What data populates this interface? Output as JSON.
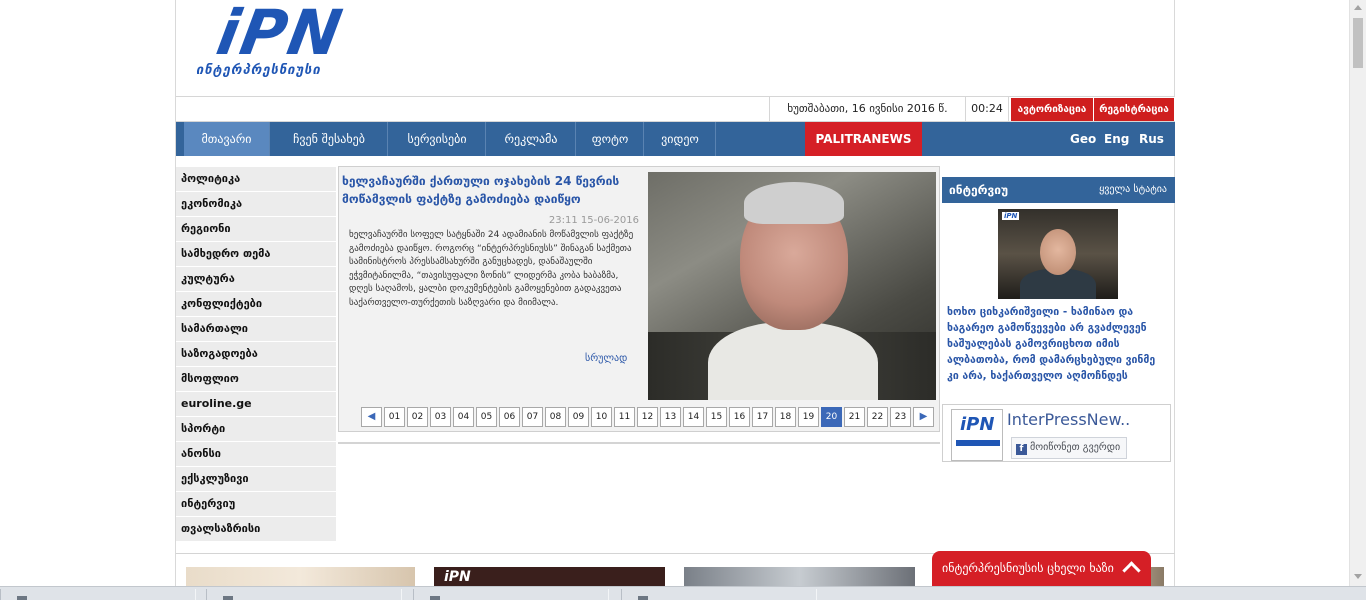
{
  "logo": {
    "mark": "iPN",
    "word": "ინტერპრესნიუსი"
  },
  "topbar": {
    "date": "ხუთშაბათი, 16 ივნისი 2016 წ.",
    "time": "00:24",
    "login_label": "ავტორიზაცია",
    "register_label": "რეგისტრაცია"
  },
  "nav": {
    "items": [
      {
        "label": "მთავარი",
        "active": true
      },
      {
        "label": "ჩვენ შესახებ",
        "active": false
      },
      {
        "label": "სერვისები",
        "active": false
      },
      {
        "label": "რეკლამა",
        "active": false
      },
      {
        "label": "ფოტო",
        "active": false
      },
      {
        "label": "ვიდეო",
        "active": false
      }
    ],
    "palitra": "PALITRANEWS",
    "languages": [
      "Geo",
      "Eng",
      "Rus"
    ]
  },
  "categories": [
    "პოლიტიკა",
    "ეკონომიკა",
    "რეგიონი",
    "სამხედრო თემა",
    "კულტურა",
    "კონფლიქტები",
    "სამართალი",
    "საზოგადოება",
    "მსოფლიო",
    "euroline.ge",
    "სპორტი",
    "ანონსი",
    "ექსკლუზივი",
    "ინტერვიუ",
    "თვალსაზრისი"
  ],
  "featured": {
    "title": "ხელვაჩაურში ქართული ოჯახების 24 წევრის მოწამვლის ფაქტზე გამოძიება დაიწყო",
    "time": "23:11 15-06-2016",
    "body": "ხელვაჩაურში სოფელ სატყნაში 24 ადამიანის მოწამვლის ფაქტზე გამოძიება დაიწყო. როგორც “ინტერპრესნიუსს” შინაგან საქმეთა სამინისტროს პრესსამსახურში განუცხადეს, დანაშაულში ეჭვმიტანილმა, “თავისუფალი ზონის” ლიდერმა კობა ხაბაზმა, დღეს საღამოს, ყალბი დოკუმენტების გამოყენებით გადაკვეთა საქართველო-თურქეთის საზღვარი და მიიმალა.",
    "more": "სრულად"
  },
  "pager": {
    "prev": "◀",
    "next": "▶",
    "pages": [
      "01",
      "02",
      "03",
      "04",
      "05",
      "06",
      "07",
      "08",
      "09",
      "10",
      "11",
      "12",
      "13",
      "14",
      "15",
      "16",
      "17",
      "18",
      "19",
      "20",
      "21",
      "22",
      "23"
    ],
    "active": "20"
  },
  "interview": {
    "heading": "ინტერვიუ",
    "all_link": "ყველა სტატია",
    "photo_tag": "iPN",
    "text": "ხოხო ციხკარიშვილი - ხამინაო და ხაგარეო გამოწვევები არ გვაძლევენ ხაშუალებას გამოვრიცხოთ იმის ალბათობა, რომ დამარცხებული ვინმე კი არა, ხაქართველო აღმოჩნდეს"
  },
  "facebook": {
    "logo": "iPN",
    "name": "InterPressNew..",
    "like": "მოიწონეთ გვერდი",
    "f": "f"
  },
  "thumb2_mark": "iPN",
  "live_button": "ინტერპრესნიუსის ცხელი ხაზი",
  "colors": {
    "brand_blue": "#1f56b5",
    "nav_blue": "#33649a",
    "red": "#cf1e1e",
    "link_blue": "#2a56a8"
  }
}
